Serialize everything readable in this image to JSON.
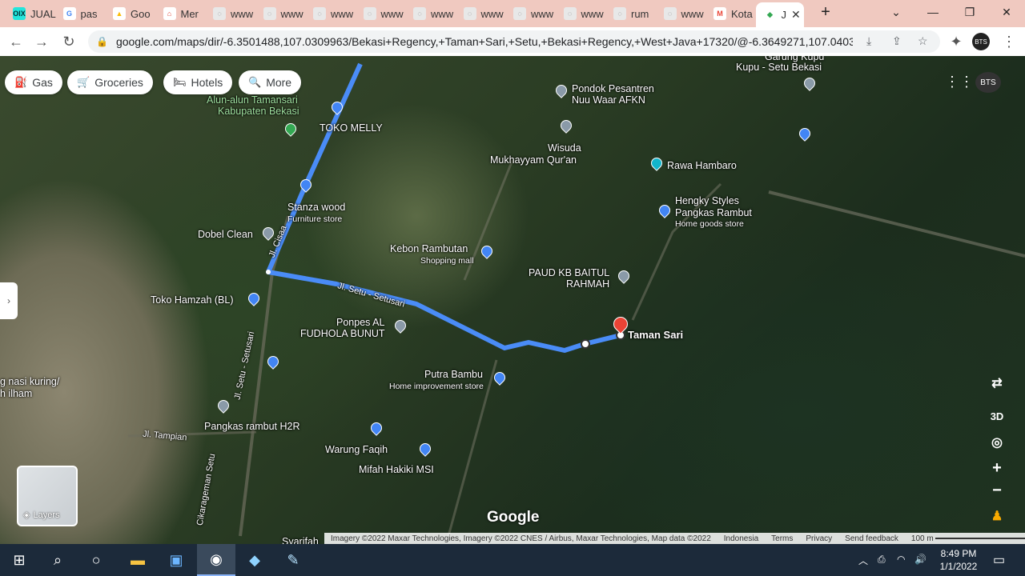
{
  "tabs": [
    {
      "label": "JUAL",
      "fav": "OlX",
      "color": "#23e5db",
      "fg": "#002f34"
    },
    {
      "label": "pas",
      "fav": "G",
      "color": "#ffffff",
      "fg": "#4285f4"
    },
    {
      "label": "Goo",
      "fav": "▲",
      "color": "#ffffff",
      "fg": "#fbbc04"
    },
    {
      "label": "Mer",
      "fav": "⌂",
      "color": "#ffffff",
      "fg": "#e04b3c"
    },
    {
      "label": "www",
      "fav": "◌",
      "color": "#e8e8e8",
      "fg": "#777"
    },
    {
      "label": "www",
      "fav": "◌",
      "color": "#e8e8e8",
      "fg": "#777"
    },
    {
      "label": "www",
      "fav": "◌",
      "color": "#e8e8e8",
      "fg": "#777"
    },
    {
      "label": "www",
      "fav": "◌",
      "color": "#e8e8e8",
      "fg": "#777"
    },
    {
      "label": "www",
      "fav": "◌",
      "color": "#e8e8e8",
      "fg": "#777"
    },
    {
      "label": "www",
      "fav": "◌",
      "color": "#e8e8e8",
      "fg": "#777"
    },
    {
      "label": "www",
      "fav": "◌",
      "color": "#e8e8e8",
      "fg": "#777"
    },
    {
      "label": "www",
      "fav": "◌",
      "color": "#e8e8e8",
      "fg": "#777"
    },
    {
      "label": "rum",
      "fav": "◌",
      "color": "#e8e8e8",
      "fg": "#777"
    },
    {
      "label": "www",
      "fav": "◌",
      "color": "#e8e8e8",
      "fg": "#777"
    },
    {
      "label": "Kota",
      "fav": "M",
      "color": "#ffffff",
      "fg": "#ea4335"
    },
    {
      "label": "J",
      "fav": "◆",
      "color": "#ffffff",
      "fg": "#34a853",
      "active": true
    }
  ],
  "url": "google.com/maps/dir/-6.3501488,107.0309963/Bekasi+Regency,+Taman+Sari,+Setu,+Bekasi+Regency,+West+Java+17320/@-6.3649271,107.04038...",
  "profile_initials": "BTS",
  "filters": [
    {
      "label": "Gas",
      "icon": "⛽"
    },
    {
      "label": "Groceries",
      "icon": "🛒"
    },
    {
      "label": "Hotels",
      "icon": "🛏"
    },
    {
      "label": "More",
      "icon": "🔍"
    }
  ],
  "places": {
    "alun_alun": "Alun-alun Tamansari",
    "alun_alun2": "Kabupaten Bekasi",
    "toko_melly": "TOKO MELLY",
    "stanza": "Stanza wood",
    "stanza_sub": "Furniture store",
    "dobel": "Dobel Clean",
    "toko_hamzah": "Toko Hamzah (BL)",
    "nasi1": "g nasi kuring/",
    "nasi2": "h ilham",
    "pangkas_h2r": "Pangkas rambut H2R",
    "tampian": "Jl. Tampian",
    "cikarageman": "Cikarageman Setu",
    "jl_setu_vert": "Jl. Setu - Setusari",
    "jl_cisaa": "Jl. Cisaa",
    "jl_setu": "Jl. Setu - Setusari",
    "kebon": "Kebon Rambutan",
    "kebon_sub": "Shopping mall",
    "ponpes1": "Ponpes AL",
    "ponpes2": "FUDHOLA BUNUT",
    "putra": "Putra Bambu",
    "putra_sub": "Home improvement store",
    "warung": "Warung Faqih",
    "mifah": "Mifah Hakiki MSI",
    "pondok1": "Pondok Pesantren",
    "pondok2": "Nuu Waar AFKN",
    "wisuda1": "Wisuda",
    "wisuda2": "Mukhayyam Qur'an",
    "rawa": "Rawa Hambaro",
    "hengky1": "Hengky Styles",
    "hengky2": "Pangkas Rambut",
    "hengky_sub": "Home goods store",
    "paud1": "PAUD KB BAITUL",
    "paud2": "RAHMAH",
    "taman_sari": "Taman Sari",
    "garung1": "Garung Kupu",
    "garung2": "Kupu - Setu Bekasi",
    "syarifah": "Syarifah"
  },
  "layers_label": "Layers",
  "control_3d": "3D",
  "google_logo": "Google",
  "attribution": {
    "imagery": "Imagery ©2022 Maxar Technologies, Imagery ©2022 CNES / Airbus, Maxar Technologies, Map data ©2022",
    "country": "Indonesia",
    "terms": "Terms",
    "privacy": "Privacy",
    "feedback": "Send feedback",
    "scale": "100 m"
  },
  "clock": {
    "time": "8:49 PM",
    "date": "1/1/2022"
  },
  "colors": {
    "route": "#4a8cf7",
    "tabstrip": "#f0c9c0"
  }
}
